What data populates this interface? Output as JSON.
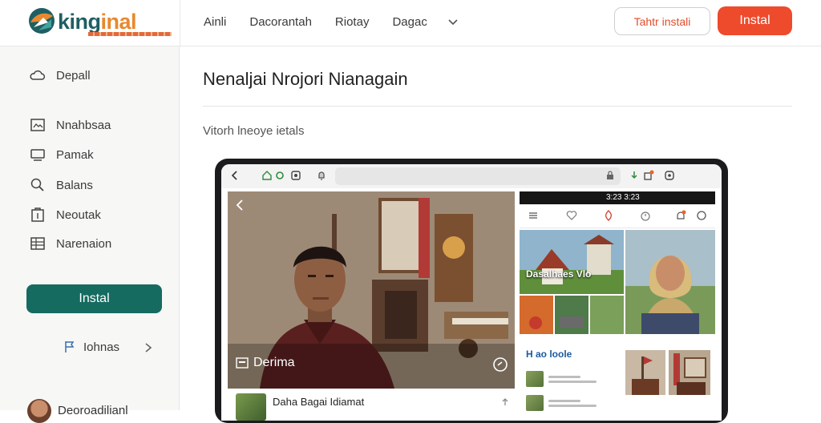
{
  "header": {
    "logo_text_a": "king",
    "logo_text_b": "inal",
    "nav": [
      "Ainli",
      "Dacorantah",
      "Riotay",
      "Dagac"
    ],
    "outline_button": "Tahtr instali",
    "primary_button": "Instal"
  },
  "sidebar": {
    "items": [
      {
        "label": "Depall",
        "icon": "cloud-icon"
      },
      {
        "label": "Nnahbsaa",
        "icon": "image-icon"
      },
      {
        "label": "Pamak",
        "icon": "monitor-icon"
      },
      {
        "label": "Balans",
        "icon": "search-icon"
      },
      {
        "label": "Neoutak",
        "icon": "clipboard-icon"
      },
      {
        "label": "Narenaion",
        "icon": "grid-icon"
      }
    ],
    "install_button": "Instal",
    "link_label": "Iohnas",
    "user_name": "Deoroadilianl"
  },
  "main": {
    "title": "Nenaljai Nrojori Nianagain",
    "subtitle": "Vitorh lneoye ietals",
    "device": {
      "photo_caption": "Derima",
      "feed_title": "Daha Bagai Idiamat",
      "status_time": "3:23 3:23",
      "tile1_label": "Dasalhaes Vlo",
      "tile2_label": "",
      "section_title": "H ao loole"
    }
  },
  "colors": {
    "brand_teal": "#156b60",
    "accent_red": "#ee4a2c",
    "outline_text": "#e24d2b"
  }
}
